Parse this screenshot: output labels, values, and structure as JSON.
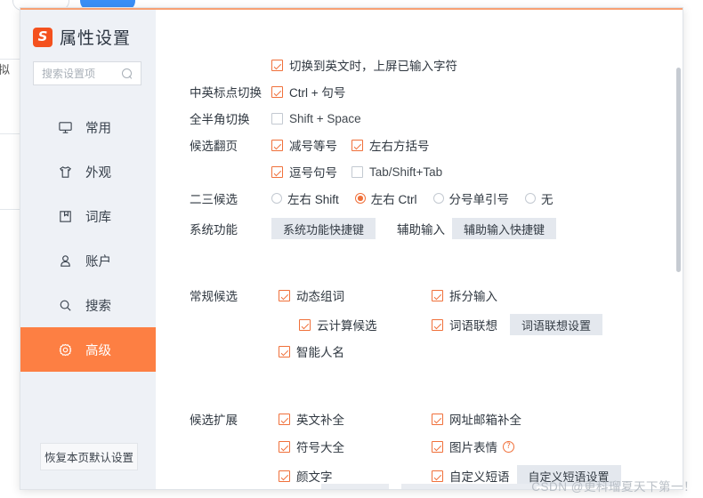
{
  "backdrop": {
    "glyph": "拟"
  },
  "window": {
    "title": "属性设置",
    "logo_letter": "S",
    "controls": [
      {
        "name": "help",
        "glyph": "?"
      },
      {
        "name": "minimize",
        "glyph": "−"
      },
      {
        "name": "close",
        "glyph": "✕"
      }
    ],
    "accent_color": "#f7a073"
  },
  "sidebar": {
    "search": {
      "value": "",
      "placeholder": "搜索设置项",
      "icon": "search-icon"
    },
    "items": [
      {
        "label": "常用",
        "icon": "monitor-icon",
        "active": false
      },
      {
        "label": "外观",
        "icon": "shirt-icon",
        "active": false
      },
      {
        "label": "词库",
        "icon": "book-icon",
        "active": false
      },
      {
        "label": "账户",
        "icon": "user-icon",
        "active": false
      },
      {
        "label": "搜索",
        "icon": "search-icon",
        "active": false
      },
      {
        "label": "高级",
        "icon": "gear-icon",
        "active": true
      }
    ],
    "active_color": "#fd7f43",
    "reset_button": "恢复本页默认设置"
  },
  "main": {
    "rows": [
      {
        "label": "",
        "items": [
          {
            "type": "checkbox",
            "label": "切换到英文时，上屏已输入字符",
            "checked": true
          }
        ]
      },
      {
        "label": "中英标点切换",
        "items": [
          {
            "type": "checkbox",
            "label": "Ctrl + 句号",
            "checked": true
          }
        ]
      },
      {
        "label": "全半角切换",
        "items": [
          {
            "type": "checkbox",
            "label": "Shift + Space",
            "checked": false
          }
        ]
      },
      {
        "label": "候选翻页",
        "items": [
          {
            "type": "checkbox",
            "label": "减号等号",
            "checked": true
          },
          {
            "type": "checkbox",
            "label": "左右方括号",
            "checked": true
          }
        ]
      },
      {
        "label": "",
        "items": [
          {
            "type": "checkbox",
            "label": "逗号句号",
            "checked": true
          },
          {
            "type": "checkbox",
            "label": "Tab/Shift+Tab",
            "checked": false
          }
        ]
      },
      {
        "label": "二三候选",
        "items": [
          {
            "type": "radio",
            "label": "左右 Shift",
            "selected": false
          },
          {
            "type": "radio",
            "label": "左右 Ctrl",
            "selected": true
          },
          {
            "type": "radio",
            "label": "分号单引号",
            "selected": false
          },
          {
            "type": "radio",
            "label": "无",
            "selected": false
          }
        ]
      },
      {
        "label": "系统功能",
        "items": [
          {
            "type": "button",
            "label": "系统功能快捷键"
          },
          {
            "type": "label",
            "label": "辅助输入"
          },
          {
            "type": "button",
            "label": "辅助输入快捷键"
          }
        ]
      }
    ],
    "group_general": {
      "title": "常规候选",
      "rows": [
        [
          {
            "type": "checkbox",
            "label": "动态组词",
            "checked": true
          },
          {
            "type": "checkbox",
            "label": "拆分输入",
            "checked": true
          }
        ],
        [
          {
            "type": "checkbox",
            "label": "云计算候选",
            "checked": true,
            "indent": true
          },
          {
            "type": "checkbox",
            "label": "词语联想",
            "checked": true
          },
          {
            "type": "button",
            "label": "词语联想设置"
          }
        ],
        [
          {
            "type": "checkbox",
            "label": "智能人名",
            "checked": true
          }
        ]
      ]
    },
    "group_extend": {
      "title": "候选扩展",
      "rows": [
        [
          {
            "type": "checkbox",
            "label": "英文补全",
            "checked": true
          },
          {
            "type": "checkbox",
            "label": "网址邮箱补全",
            "checked": true
          }
        ],
        [
          {
            "type": "checkbox",
            "label": "符号大全",
            "checked": true
          },
          {
            "type": "checkbox",
            "label": "图片表情",
            "checked": true,
            "help": true
          }
        ],
        [
          {
            "type": "checkbox",
            "label": "颜文字",
            "checked": true
          },
          {
            "type": "checkbox",
            "label": "自定义短语",
            "checked": true
          },
          {
            "type": "button",
            "label": "自定义短语设置"
          }
        ]
      ]
    }
  },
  "watermark": "CSDN @更科瑠夏天下第一！"
}
